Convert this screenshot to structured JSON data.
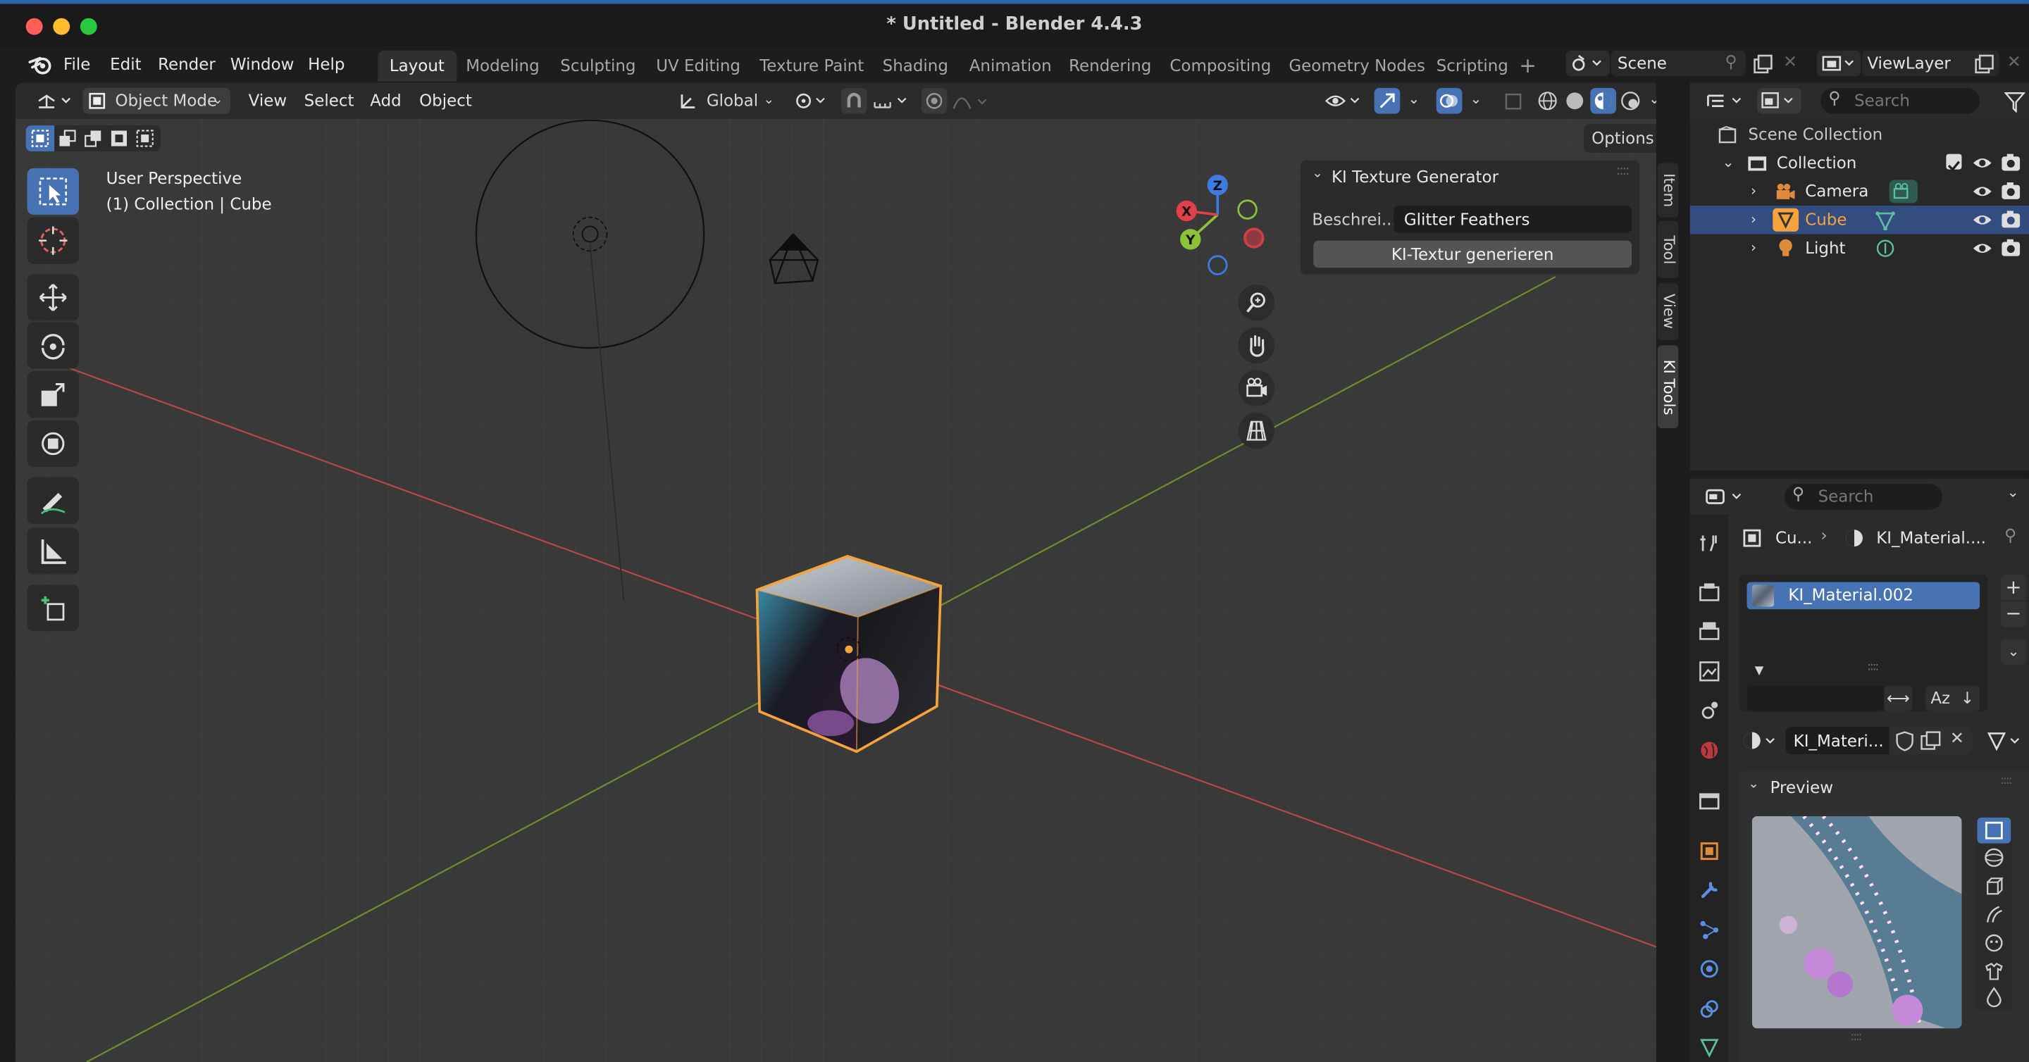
{
  "window": {
    "title": "* Untitled - Blender 4.4.3"
  },
  "menu": [
    "File",
    "Edit",
    "Render",
    "Window",
    "Help"
  ],
  "workspaces": [
    "Layout",
    "Modeling",
    "Sculpting",
    "UV Editing",
    "Texture Paint",
    "Shading",
    "Animation",
    "Rendering",
    "Compositing",
    "Geometry Nodes",
    "Scripting"
  ],
  "active_workspace": "Layout",
  "scene": {
    "name": "Scene",
    "view_layer": "ViewLayer"
  },
  "viewport": {
    "mode": "Object Mode",
    "menus": [
      "View",
      "Select",
      "Add",
      "Object"
    ],
    "transform_orientation": "Global",
    "options_label": "Options",
    "overlay_line1": "User Perspective",
    "overlay_line2": "(1) Collection | Cube",
    "gizmo": {
      "x": "X",
      "y": "Y",
      "z": "Z"
    }
  },
  "side_tabs": [
    "Item",
    "Tool",
    "View",
    "KI Tools"
  ],
  "ki_panel": {
    "title": "KI Texture Generator",
    "field_label": "Beschrei...",
    "field_value": "Glitter Feathers",
    "button": "KI-Textur generieren"
  },
  "outliner": {
    "search_placeholder": "Search",
    "scene_collection": "Scene Collection",
    "collection": "Collection",
    "items": [
      {
        "name": "Camera"
      },
      {
        "name": "Cube",
        "selected": true
      },
      {
        "name": "Light"
      }
    ]
  },
  "properties": {
    "search_placeholder": "Search",
    "breadcrumb_object": "Cu...",
    "breadcrumb_material": "KI_Material....",
    "material_slot": "KI_Material.002",
    "material_name": "KI_Materi...",
    "sort_label": "Az",
    "preview_label": "Preview"
  },
  "colors": {
    "accent": "#4772b3",
    "selected_orange": "#f5a33c",
    "x_axis": "#e0404a",
    "y_axis": "#8bc23a",
    "z_axis": "#3e7be0"
  }
}
